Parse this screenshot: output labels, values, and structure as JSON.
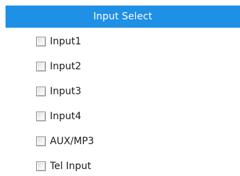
{
  "header": {
    "title": "Input Select"
  },
  "inputs": [
    {
      "label": "Input1",
      "checked": false
    },
    {
      "label": "Input2",
      "checked": false
    },
    {
      "label": "Input3",
      "checked": false
    },
    {
      "label": "Input4",
      "checked": false
    },
    {
      "label": "AUX/MP3",
      "checked": false
    },
    {
      "label": "Tel Input",
      "checked": false
    }
  ],
  "colors": {
    "header_background": "#1e90e6",
    "header_text": "#ffffff"
  }
}
